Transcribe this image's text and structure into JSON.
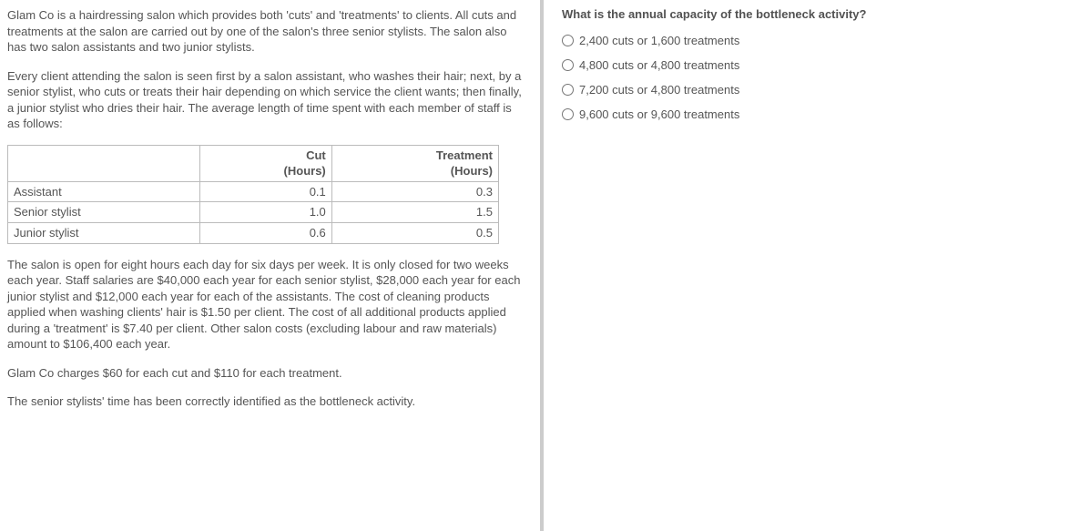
{
  "left": {
    "p1": "Glam Co is a hairdressing salon which provides both 'cuts' and 'treatments' to clients. All cuts and treatments at the salon are carried out by one of the salon's three senior stylists. The salon also has two salon assistants and two junior stylists.",
    "p2": "Every client attending the salon is seen first by a salon assistant, who washes their hair; next, by a senior stylist, who cuts or treats their hair depending on which service the client wants; then finally, a junior stylist who dries their hair. The average length of time spent with each member of staff is as follows:",
    "table": {
      "col1_label": "Cut",
      "col1_unit": "(Hours)",
      "col2_label": "Treatment",
      "col2_unit": "(Hours)",
      "rows": [
        {
          "label": "Assistant",
          "cut": "0.1",
          "treatment": "0.3"
        },
        {
          "label": "Senior stylist",
          "cut": "1.0",
          "treatment": "1.5"
        },
        {
          "label": "Junior stylist",
          "cut": "0.6",
          "treatment": "0.5"
        }
      ]
    },
    "p3": "The salon is open for eight hours each day for six days per week. It is only closed for two weeks each year. Staff salaries are $40,000 each year for each senior stylist, $28,000 each year for each junior stylist and $12,000 each year for each of the assistants. The cost of cleaning products applied when washing clients' hair is $1.50 per client. The cost of all additional products applied during a 'treatment' is $7.40 per client. Other salon costs (excluding labour and raw materials) amount to $106,400 each year.",
    "p4": "Glam Co charges $60 for each cut and $110 for each treatment.",
    "p5": "The senior stylists' time has been correctly identified as the bottleneck activity."
  },
  "right": {
    "question": "What is the annual capacity of the bottleneck activity?",
    "options": [
      "2,400 cuts or 1,600 treatments",
      "4,800 cuts or 4,800 treatments",
      "7,200 cuts or 4,800 treatments",
      "9,600 cuts or 9,600 treatments"
    ]
  }
}
